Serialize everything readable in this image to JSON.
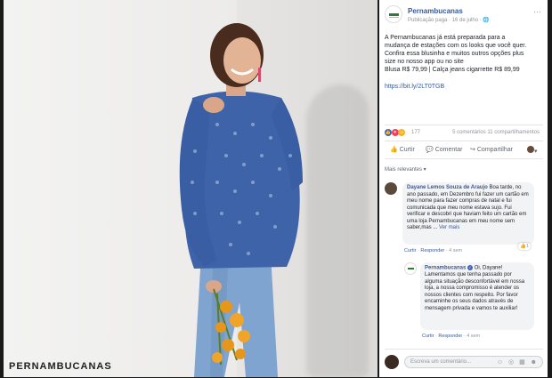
{
  "photo": {
    "watermark": "PERNAMBUCANAS"
  },
  "post": {
    "page_name": "Pernambucanas",
    "meta": "Publicação paga · 16 de julho · 🌐",
    "menu": "···",
    "text_lines": [
      "A Pernambucanas já está preparada para a",
      "mudança de estações com os looks que você quer.",
      "Confira essa blusinha e muitos outros opções plus",
      "size no nosso app ou no site",
      "Blusa R$ 79,99 | Calça jeans cigarrette R$ 89,99"
    ],
    "link": "https://bit.ly/2LT0TGB",
    "reaction_count": "177",
    "stats": "5 comentários 11 compartilhamentos",
    "actions": {
      "like": "Curtir",
      "comment": "Comentar",
      "share": "Compartilhar"
    },
    "sort_label": "Mais relevantes ▾"
  },
  "comments": [
    {
      "author": "Dayane Lemos Souza de Araujo",
      "text": "Boa tarde, no ano passado, em Dezembro fui fazer um cartão em meu nome para fazer compras de natal e fui comunicada que meu nome estava sujo. Fui verificar e descobri que haviam feito um cartão em uma loja Pernambucanas em meu nome sem saber,mas ... ",
      "more": "Ver mais",
      "like": "Curtir",
      "reply": "Responder",
      "age": "4 sem",
      "reactions": "1"
    },
    {
      "author": "Pernambucanas",
      "greeting": "Oi, Dayane!",
      "text": "Lamentamos que tenha passado por alguma situação desconfortável em nossa loja, a nossa compromisso é atender os nossos clientes com respeito. Por favor encaminhe os seus dados através de mensagem privada e vamos te auxiliar!",
      "like": "Curtir",
      "reply": "Responder",
      "age": "4 sem"
    }
  ],
  "composer": {
    "placeholder": "Escreva um comentário...",
    "icons": "☺ ◎ ▦ ☻"
  },
  "colors": {
    "link": "#385898",
    "brand_green": "#2e7d32",
    "brand_yellow": "#f2c200",
    "blouse": "#3f63a8",
    "jeans": "#7ea3cf",
    "flowers": "#e7961c"
  }
}
